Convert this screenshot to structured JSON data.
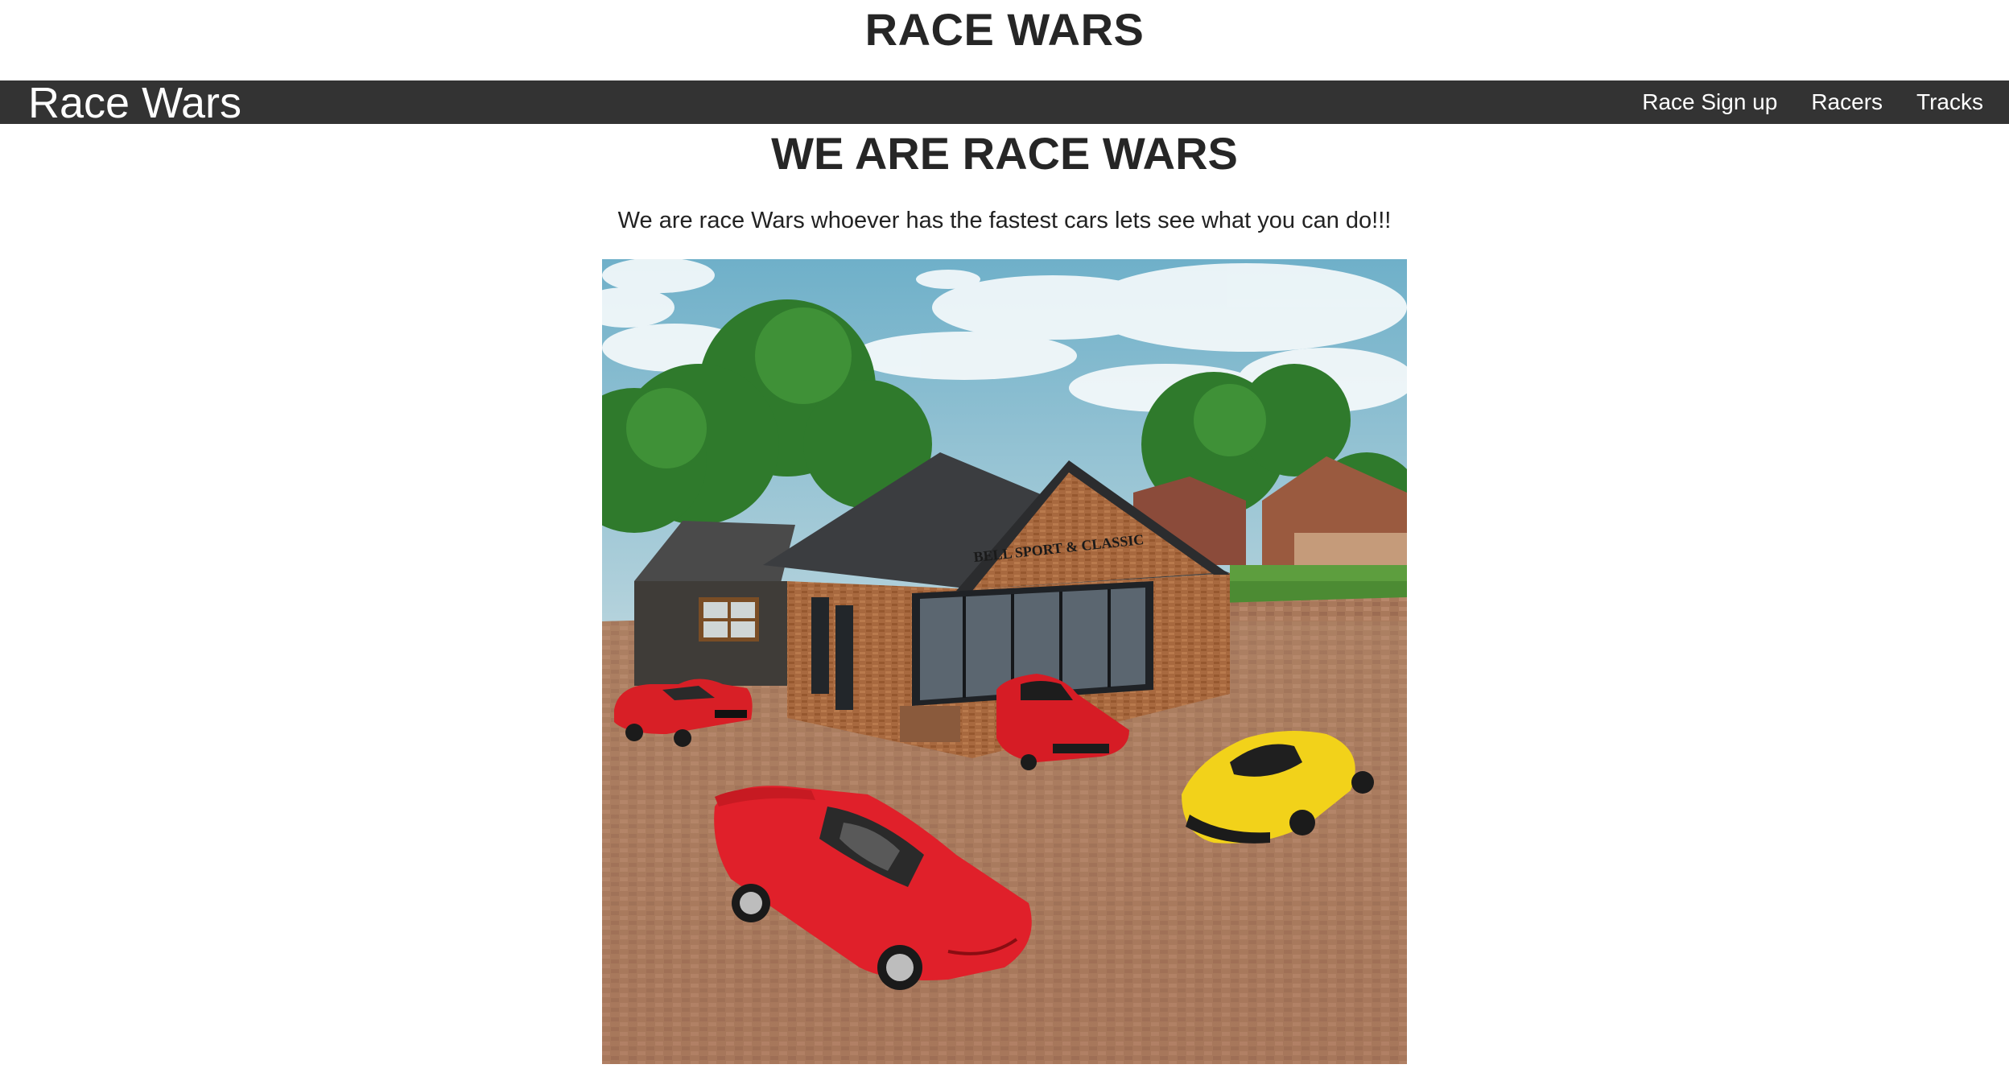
{
  "page": {
    "title": "RACE WARS"
  },
  "navbar": {
    "brand": "Race Wars",
    "links": [
      {
        "label": "Race Sign up"
      },
      {
        "label": "Racers"
      },
      {
        "label": "Tracks"
      }
    ],
    "background": "#333333"
  },
  "hero": {
    "heading": "WE ARE RACE WARS",
    "text": "We are race Wars whoever has the fastest cars lets see what you can do!!!",
    "image": {
      "sign_text": "BELL SPORT & CLASSIC"
    }
  }
}
